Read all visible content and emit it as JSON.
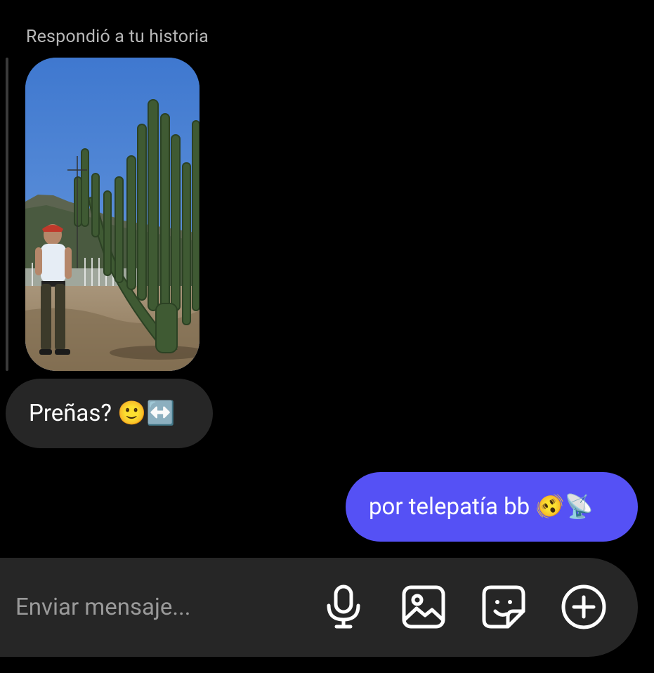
{
  "reply_context": {
    "caption": "Respondió a tu historia"
  },
  "messages": {
    "received": {
      "text": "Preñas? 🙂↔️"
    },
    "sent": {
      "text": "por telepatía bb 🫨📡"
    }
  },
  "composer": {
    "placeholder": "Enviar mensaje..."
  },
  "icons": {
    "microphone": "microphone-icon",
    "gallery": "image-icon",
    "sticker": "sticker-icon",
    "add": "plus-circle-icon"
  },
  "colors": {
    "background": "#000000",
    "received_bubble": "#262626",
    "sent_bubble": "#5551f5",
    "composer": "#262626",
    "caption": "#b8b8b8"
  }
}
